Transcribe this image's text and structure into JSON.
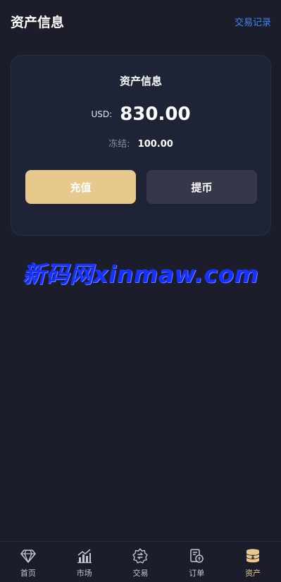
{
  "header": {
    "title": "资产信息",
    "link_label": "交易记录"
  },
  "card": {
    "title": "资产信息",
    "currency": "USD:",
    "balance": "830.00",
    "frozen_label": "冻结:",
    "frozen_value": "100.00",
    "deposit_label": "充值",
    "withdraw_label": "提币"
  },
  "watermark": "新码网xinmaw.com",
  "tabbar": {
    "items": [
      {
        "label": "首页",
        "icon": "diamond-icon"
      },
      {
        "label": "市场",
        "icon": "chart-icon"
      },
      {
        "label": "交易",
        "icon": "exchange-icon"
      },
      {
        "label": "订单",
        "icon": "order-icon"
      },
      {
        "label": "资产",
        "icon": "coin-stack-icon",
        "active": true
      }
    ]
  },
  "colors": {
    "background": "#1b1d2b",
    "card": "#1f2336",
    "accent_gold": "#e8c98d",
    "link_blue": "#3f86f2",
    "watermark_blue": "#1630ff"
  }
}
